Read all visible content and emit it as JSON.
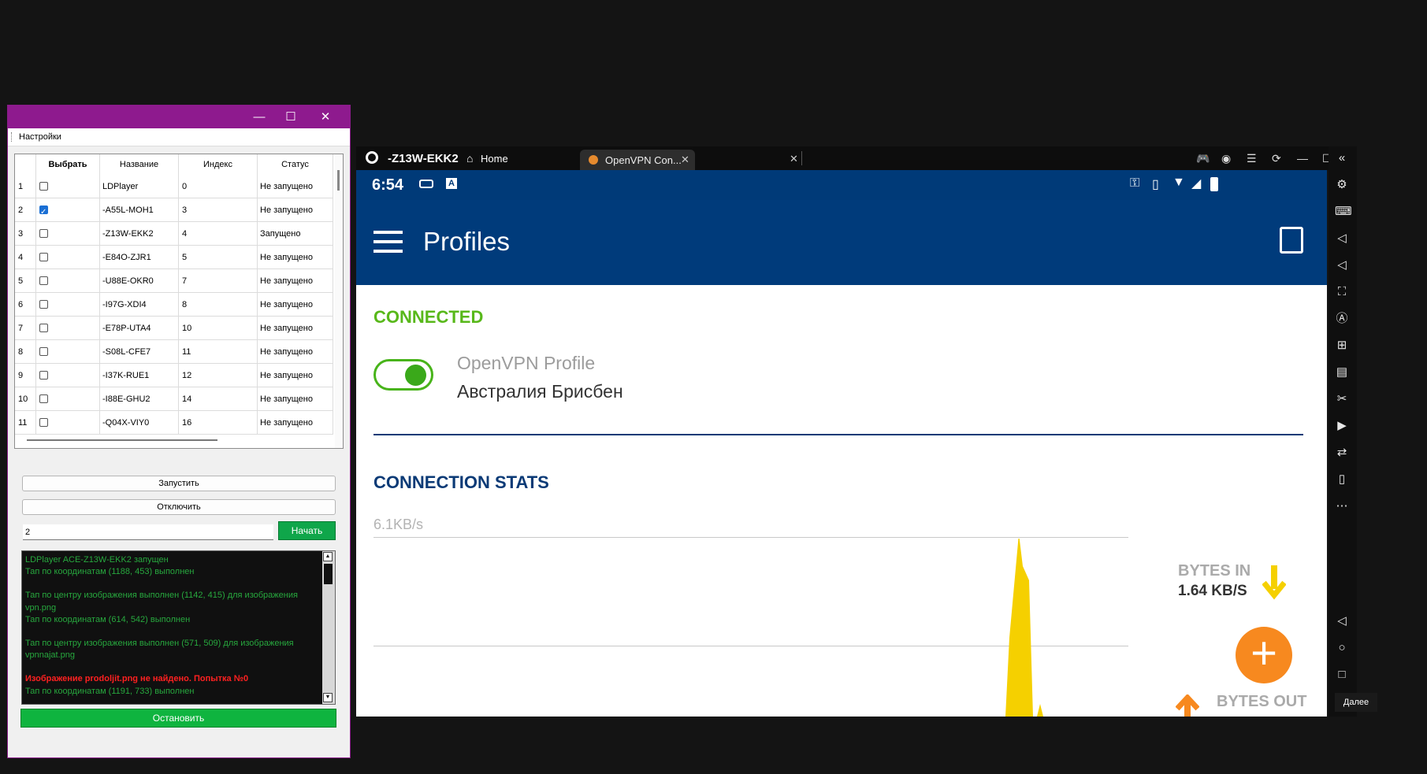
{
  "settings_window": {
    "controls": {
      "minimize": "—",
      "maximize": "☐",
      "close": "✕"
    },
    "menu": "Настройки",
    "table": {
      "headers": [
        "Выбрать",
        "Название",
        "Индекс",
        "Статус"
      ],
      "rows": [
        {
          "n": "1",
          "checked": false,
          "name": "LDPlayer",
          "index": "0",
          "status": "Не запущено"
        },
        {
          "n": "2",
          "checked": true,
          "name": "-A55L-MOH1",
          "index": "3",
          "status": "Не запущено"
        },
        {
          "n": "3",
          "checked": false,
          "name": "-Z13W-EKK2",
          "index": "4",
          "status": "Запущено"
        },
        {
          "n": "4",
          "checked": false,
          "name": "-E84O-ZJR1",
          "index": "5",
          "status": "Не запущено"
        },
        {
          "n": "5",
          "checked": false,
          "name": "-U88E-OKR0",
          "index": "7",
          "status": "Не запущено"
        },
        {
          "n": "6",
          "checked": false,
          "name": "-I97G-XDI4",
          "index": "8",
          "status": "Не запущено"
        },
        {
          "n": "7",
          "checked": false,
          "name": "-E78P-UTA4",
          "index": "10",
          "status": "Не запущено"
        },
        {
          "n": "8",
          "checked": false,
          "name": "-S08L-CFE7",
          "index": "11",
          "status": "Не запущено"
        },
        {
          "n": "9",
          "checked": false,
          "name": "-I37K-RUE1",
          "index": "12",
          "status": "Не запущено"
        },
        {
          "n": "10",
          "checked": false,
          "name": "-I88E-GHU2",
          "index": "14",
          "status": "Не запущено"
        },
        {
          "n": "11",
          "checked": false,
          "name": "-Q04X-VIY0",
          "index": "16",
          "status": "Не запущено"
        }
      ]
    },
    "launch_button": "Запустить",
    "disconnect_button": "Отключить",
    "count_input": "2",
    "start_button": "Начать",
    "log": {
      "lines": [
        {
          "text": "LDPlayer ACE-Z13W-EKK2 запущен",
          "error": false
        },
        {
          "text": "Тап по координатам (1188, 453) выполнен",
          "error": false
        },
        {
          "text": "",
          "error": false
        },
        {
          "text": "Тап по центру изображения выполнен (1142, 415) для изображения vpn.png",
          "error": false
        },
        {
          "text": "Тап по координатам (614, 542) выполнен",
          "error": false
        },
        {
          "text": "",
          "error": false
        },
        {
          "text": "Тап по центру изображения выполнен (571, 509) для изображения vpnnajat.png",
          "error": false
        },
        {
          "text": "",
          "error": false
        },
        {
          "text": "Изображение prodoljit.png не найдено. Попытка №0",
          "error": true
        },
        {
          "text": "Тап по координатам (1191, 733) выполнен",
          "error": false
        }
      ]
    },
    "stop_button": "Остановить"
  },
  "emulator": {
    "title": "-Z13W-EKK2",
    "tabs": {
      "home": "Home",
      "vpn": "OpenVPN Con..."
    },
    "android": {
      "time": "6:54",
      "app_title": "Profiles",
      "connection_state": "CONNECTED",
      "profile_name": "OpenVPN Profile",
      "profile_desc": "Австралия Брисбен",
      "stats_title": "CONNECTION STATS",
      "speed_label": "6.1KB/s",
      "bytes_in_label": "BYTES IN",
      "bytes_in_value": "1.64 KB/S",
      "bytes_out_label": "BYTES OUT"
    },
    "tooltip": "Далее"
  },
  "colors": {
    "accent_purple": "#8e1a8e",
    "vpn_blue": "#003b7b",
    "connected_green": "#58b81a",
    "fab_orange": "#f7891f",
    "graph_yellow": "#f5d000"
  }
}
